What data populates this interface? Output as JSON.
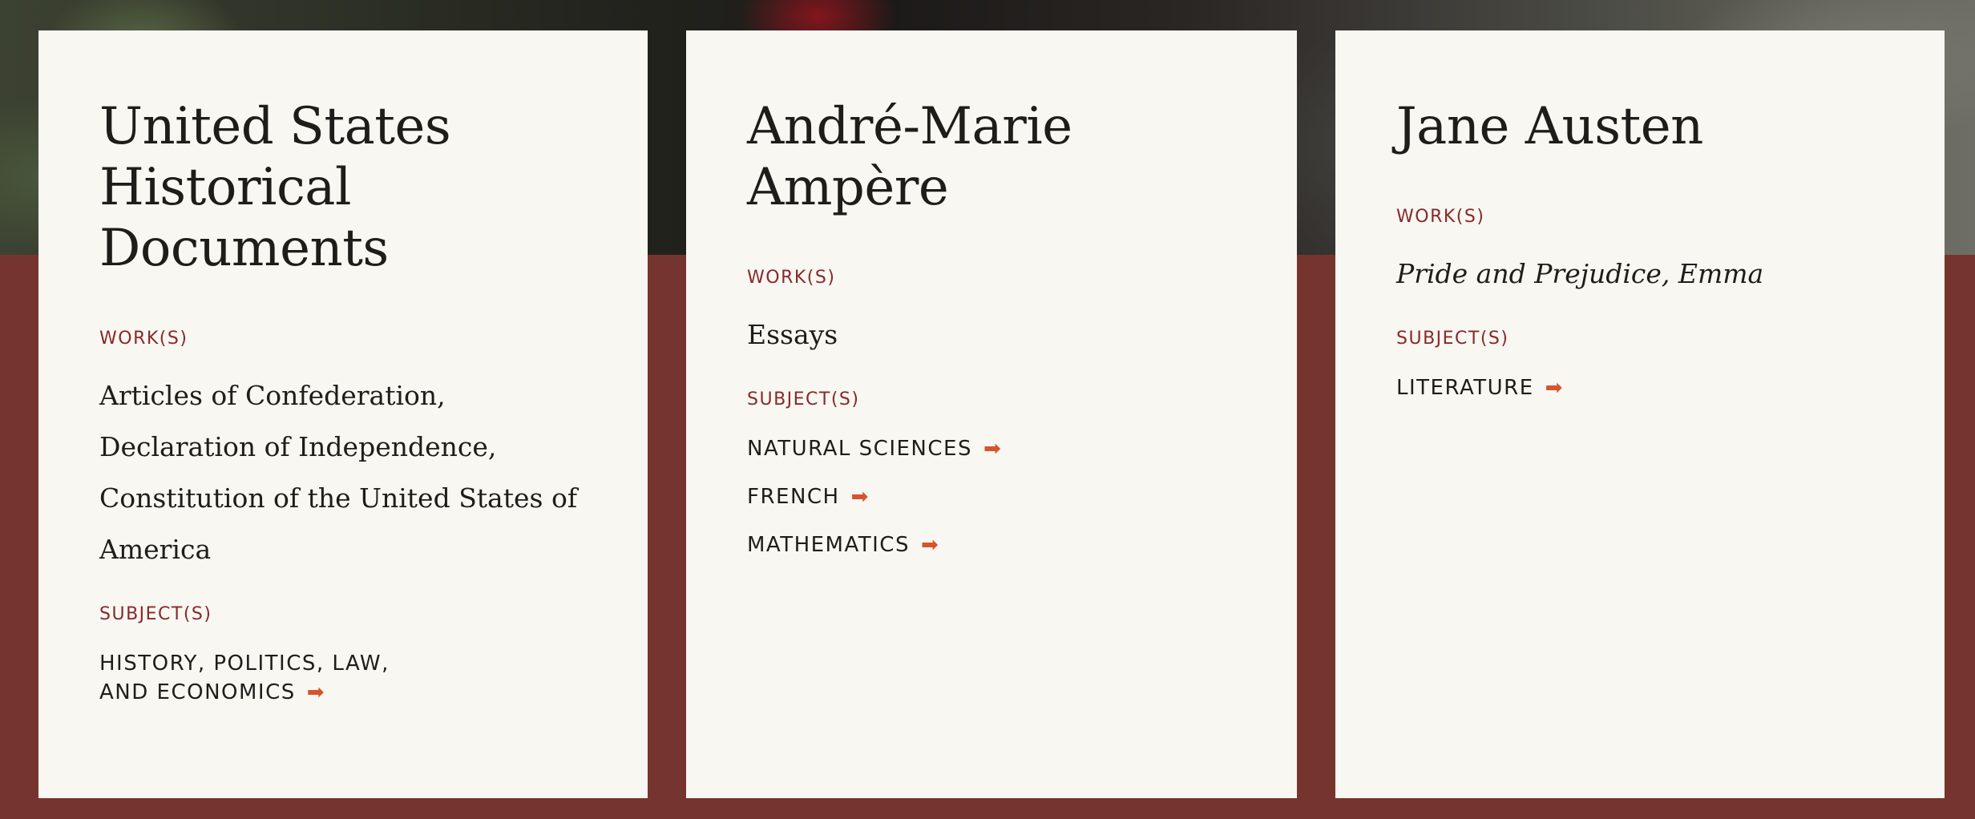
{
  "cards": [
    {
      "author": "United States Historical Documents",
      "works_label": "WORK(S)",
      "works": "Articles of Confederation, Declaration of Independence, Constitution of the United States of America",
      "subjects_label": "SUBJECT(S)",
      "subjects": [
        "HISTORY, POLITICS, LAW, AND ECONOMICS"
      ]
    },
    {
      "author": "André-Marie Ampère",
      "works_label": "WORK(S)",
      "works": "Essays",
      "subjects_label": "SUBJECT(S)",
      "subjects": [
        "NATURAL SCIENCES",
        "FRENCH",
        "MATHEMATICS"
      ]
    },
    {
      "author": "Jane Austen",
      "works_label": "WORK(S)",
      "works": "Pride and Prejudice, Emma",
      "subjects_label": "SUBJECT(S)",
      "subjects": [
        "LITERATURE"
      ]
    }
  ],
  "icons": {
    "subject_link": "arrow-right-icon",
    "arrow_glyph": "➡"
  },
  "colors": {
    "background": "#75352e",
    "card": "#f8f7f2",
    "label": "#87292b",
    "arrow": "#d4552e",
    "text": "#1e1d1a"
  }
}
